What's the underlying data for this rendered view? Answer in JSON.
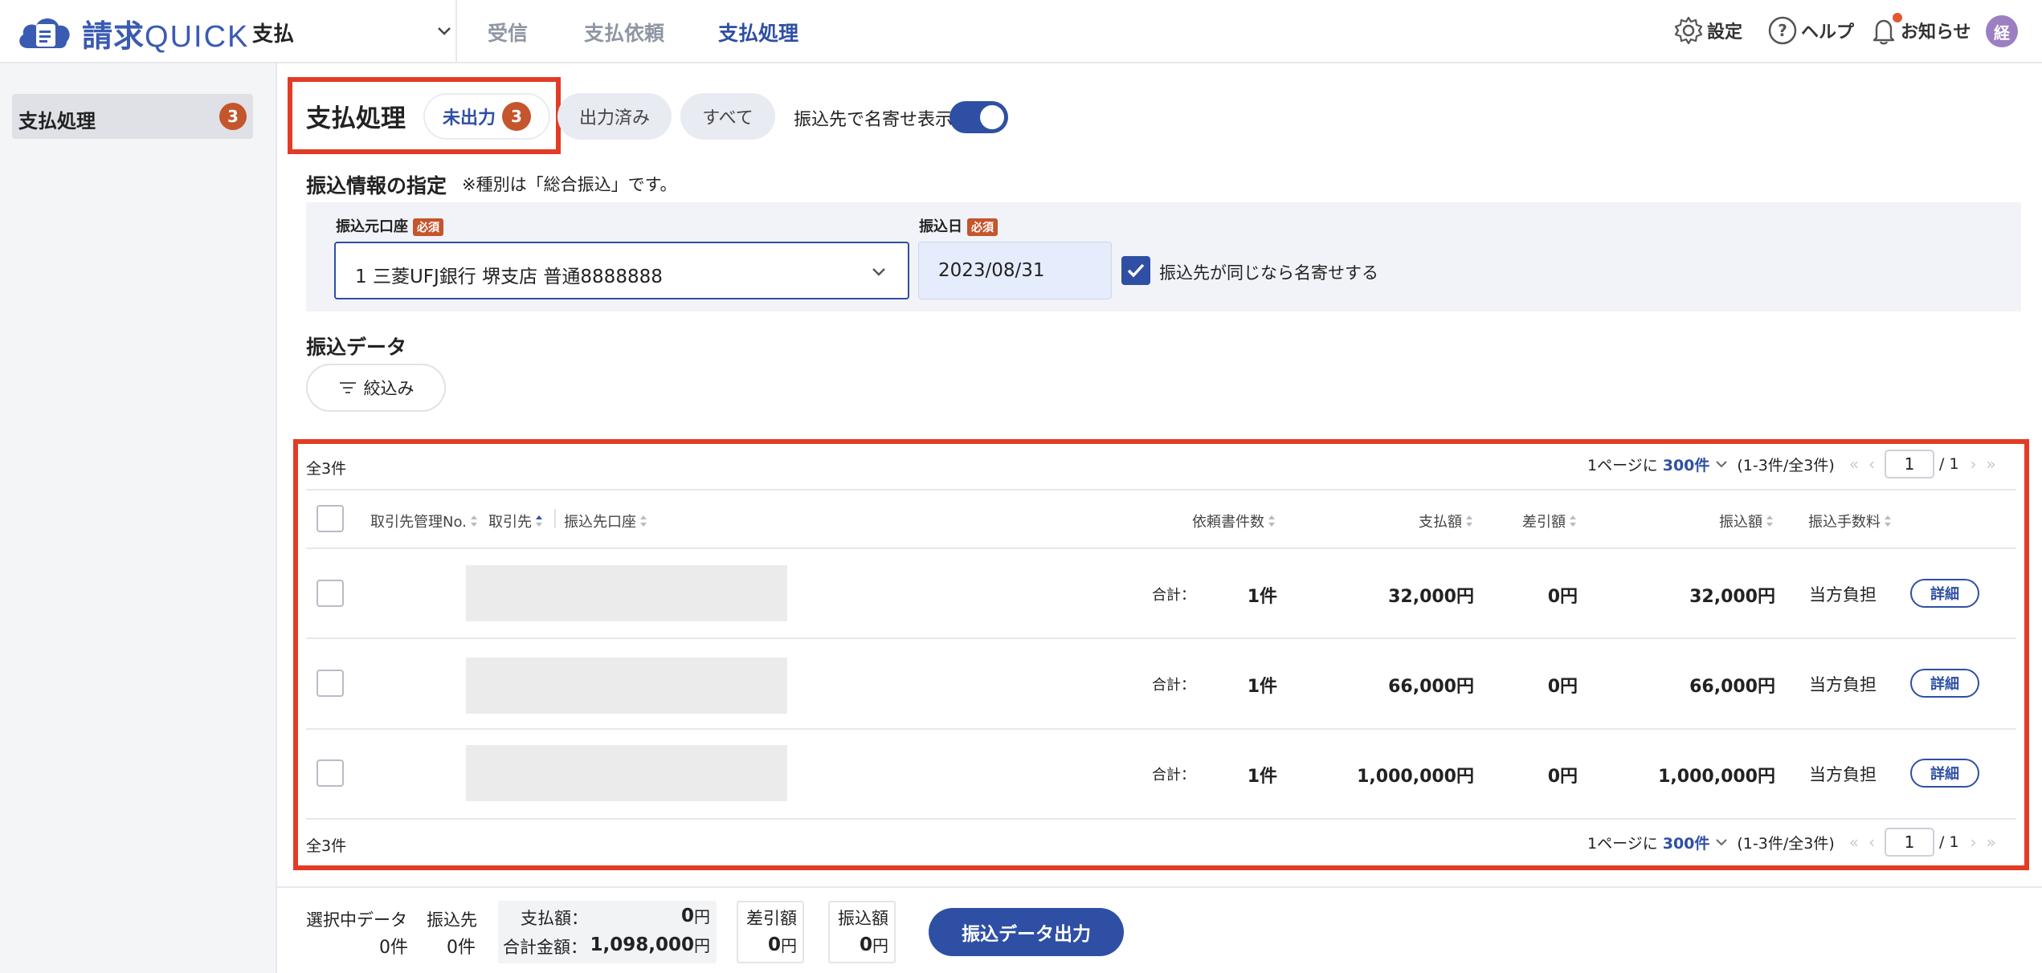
{
  "header": {
    "logo_kanji": "請求",
    "logo_latin": "QUICK",
    "module": "支払",
    "nav": [
      {
        "label": "受信"
      },
      {
        "label": "支払依頼"
      },
      {
        "label": "支払処理"
      }
    ],
    "settings_label": "設定",
    "help_label": "ヘルプ",
    "notice_label": "お知らせ",
    "avatar_initial": "経"
  },
  "sidebar": {
    "items": [
      {
        "label": "支払処理",
        "badge": "3"
      }
    ]
  },
  "page": {
    "title": "支払処理",
    "tabs": [
      {
        "label": "未出力",
        "badge": "3"
      },
      {
        "label": "出力済み"
      },
      {
        "label": "すべて"
      }
    ],
    "toggle_label": "振込先で名寄せ表示"
  },
  "transfer_info": {
    "title": "振込情報の指定",
    "note": "※種別は「総合振込」です。",
    "account_label": "振込元口座",
    "required": "必須",
    "account_value": "1 三菱UFJ銀行 堺支店 普通8888888",
    "date_label": "振込日",
    "date_value": "2023/08/31",
    "merge_label": "振込先が同じなら名寄せする"
  },
  "transfer_data": {
    "title": "振込データ",
    "filter_label": "絞込み",
    "total": "全3件",
    "per_page_prefix": "1ページに",
    "per_page_value": "300件",
    "range": "(1-3件/全3件)",
    "page_current": "1",
    "page_total": "/ 1",
    "columns": {
      "mgmt_no": "取引先管理No.",
      "partner": "取引先",
      "account": "振込先口座",
      "doc_count": "依頼書件数",
      "payment": "支払額",
      "deduction": "差引額",
      "transfer": "振込額",
      "fee": "振込手数料"
    },
    "rows": [
      {
        "sum_label": "合計：",
        "count": "1件",
        "payment": "32,000円",
        "deduction": "0円",
        "transfer": "32,000円",
        "fee": "当方負担",
        "detail": "詳細"
      },
      {
        "sum_label": "合計：",
        "count": "1件",
        "payment": "66,000円",
        "deduction": "0円",
        "transfer": "66,000円",
        "fee": "当方負担",
        "detail": "詳細"
      },
      {
        "sum_label": "合計：",
        "count": "1件",
        "payment": "1,000,000円",
        "deduction": "0円",
        "transfer": "1,000,000円",
        "fee": "当方負担",
        "detail": "詳細"
      }
    ]
  },
  "footer": {
    "selected_label": "選択中データ",
    "selected_value": "0件",
    "payee_label": "振込先",
    "payee_value": "0件",
    "payment_label": "支払額：",
    "payment_value": "0",
    "total_label": "合計金額：",
    "total_value": "1,098,000",
    "yen": "円",
    "deduction_label": "差引額",
    "deduction_value": "0",
    "transfer_label": "振込額",
    "transfer_value": "0",
    "export_label": "振込データ出力"
  },
  "colors": {
    "accent": "#2f4fa4",
    "badge": "#c4552c",
    "highlight": "#e23c26"
  }
}
